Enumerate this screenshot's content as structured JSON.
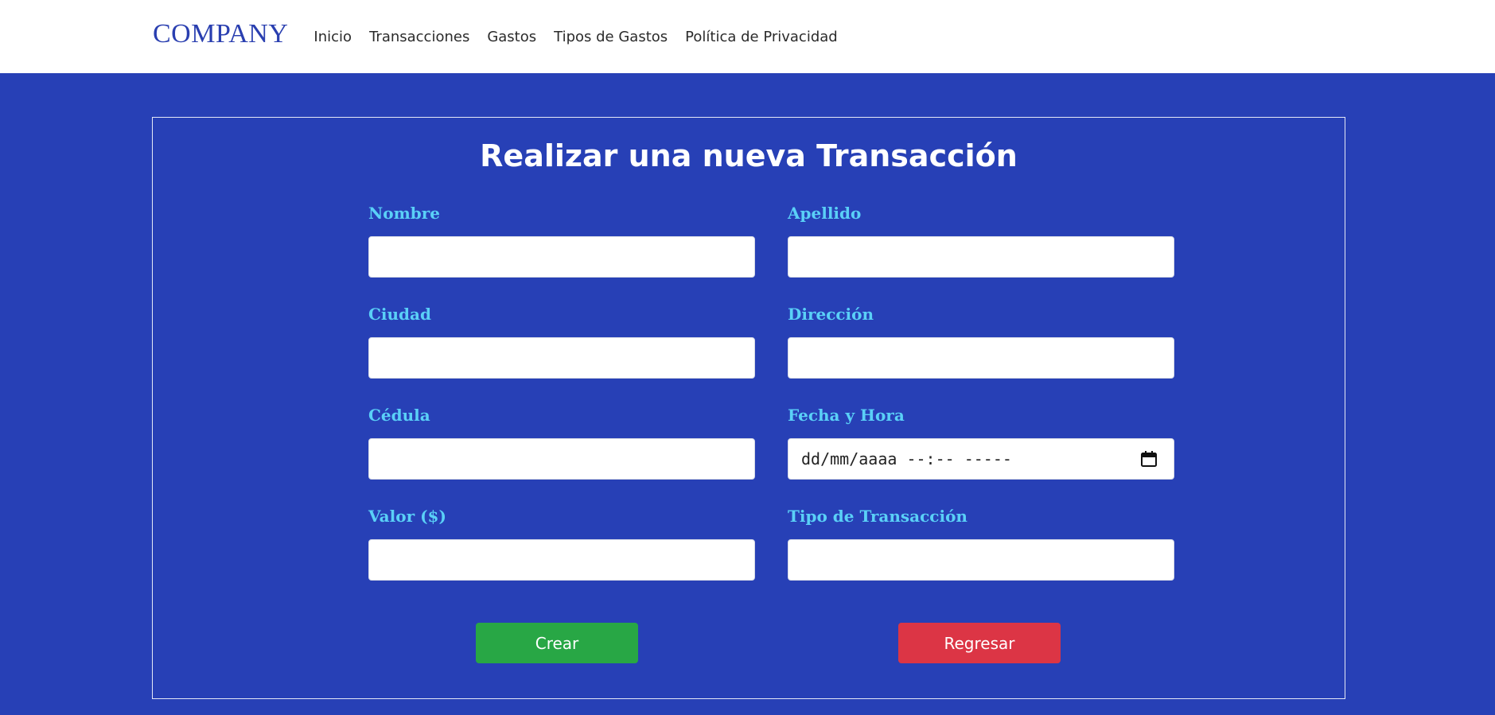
{
  "navbar": {
    "brand": "COMPANY",
    "links": [
      "Inicio",
      "Transacciones",
      "Gastos",
      "Tipos de Gastos",
      "Política de Privacidad"
    ]
  },
  "form": {
    "title": "Realizar una nueva Transacción",
    "fields": {
      "nombre": {
        "label": "Nombre",
        "value": ""
      },
      "apellido": {
        "label": "Apellido",
        "value": ""
      },
      "ciudad": {
        "label": "Ciudad",
        "value": ""
      },
      "direccion": {
        "label": "Dirección",
        "value": ""
      },
      "cedula": {
        "label": "Cédula",
        "value": ""
      },
      "fecha": {
        "label": "Fecha y Hora",
        "value": "dd/mm/aaaa --:-- -----"
      },
      "valor": {
        "label": "Valor ($)",
        "value": ""
      },
      "tipo": {
        "label": "Tipo de Transacción",
        "value": ""
      }
    },
    "buttons": {
      "create": "Crear",
      "back": "Regresar"
    }
  },
  "colors": {
    "background": "#2740b6",
    "brand": "#2a3fb0",
    "label": "#5ad0f7",
    "create_button": "#28a745",
    "back_button": "#dc3545"
  },
  "icons": {
    "date_picker": "calendar-icon"
  }
}
